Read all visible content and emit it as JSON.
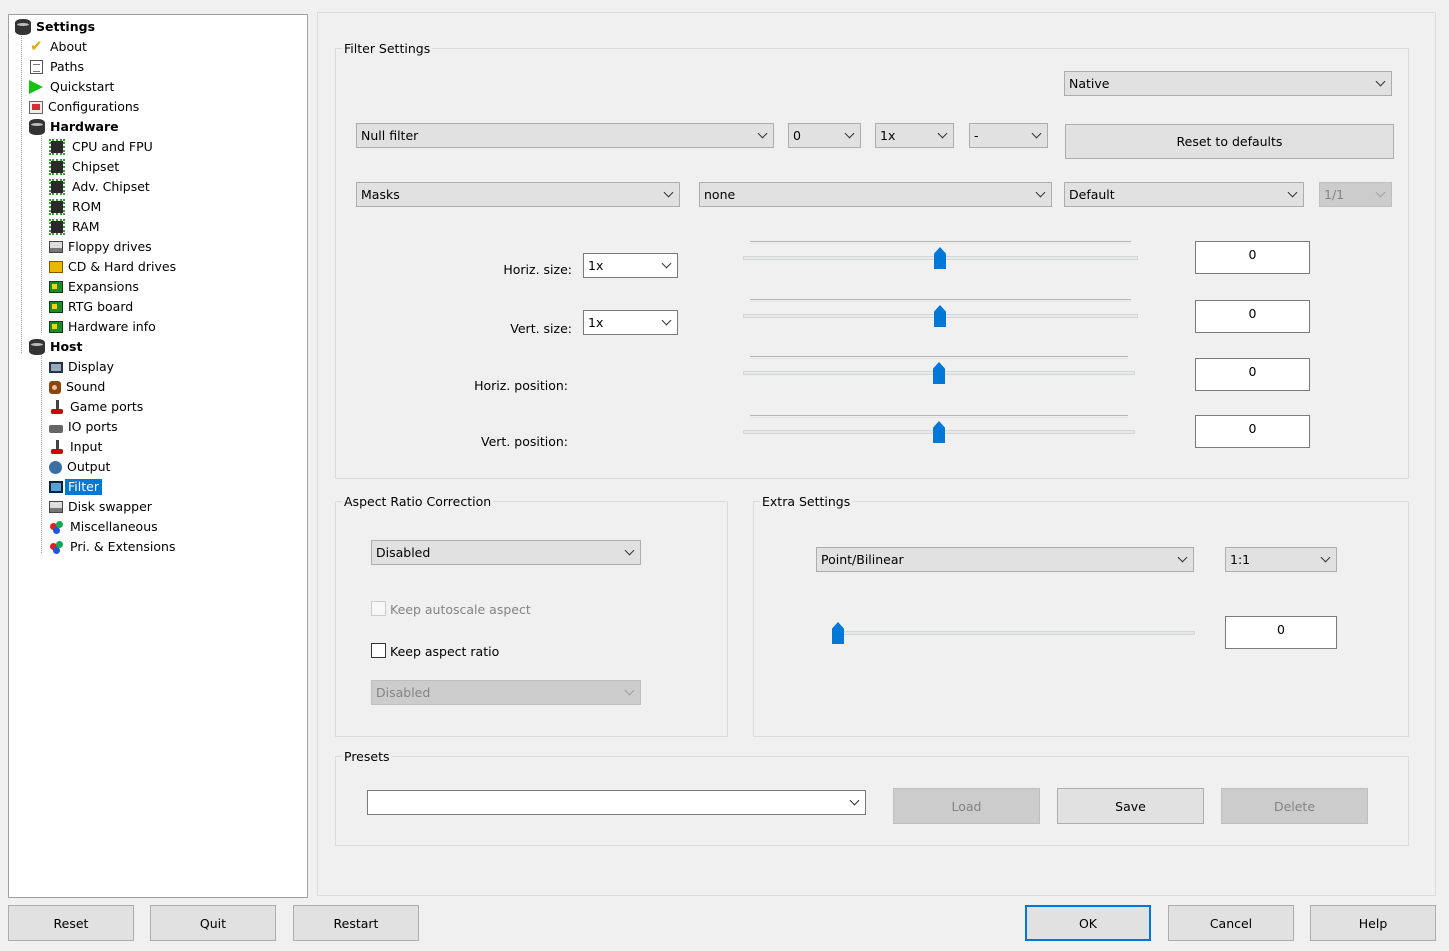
{
  "tree": {
    "items": [
      {
        "label": "Settings",
        "icon": "database-icon"
      },
      {
        "label": "About",
        "icon": "checkmark-icon"
      },
      {
        "label": "Paths",
        "icon": "document-icon"
      },
      {
        "label": "Quickstart",
        "icon": "play-icon"
      },
      {
        "label": "Configurations",
        "icon": "configurations-icon"
      },
      {
        "label": "Hardware",
        "icon": "database-icon"
      },
      {
        "label": "CPU and FPU",
        "icon": "chip-icon"
      },
      {
        "label": "Chipset",
        "icon": "chip-icon"
      },
      {
        "label": "Adv. Chipset",
        "icon": "chip-icon"
      },
      {
        "label": "ROM",
        "icon": "chip-icon"
      },
      {
        "label": "RAM",
        "icon": "chip-icon"
      },
      {
        "label": "Floppy drives",
        "icon": "floppy-icon"
      },
      {
        "label": "CD & Hard drives",
        "icon": "cd-drive-icon"
      },
      {
        "label": "Expansions",
        "icon": "expansion-card-icon"
      },
      {
        "label": "RTG board",
        "icon": "expansion-card-icon"
      },
      {
        "label": "Hardware info",
        "icon": "expansion-card-icon"
      },
      {
        "label": "Host",
        "icon": "database-icon"
      },
      {
        "label": "Display",
        "icon": "monitor-icon"
      },
      {
        "label": "Sound",
        "icon": "speaker-icon"
      },
      {
        "label": "Game ports",
        "icon": "joystick-icon"
      },
      {
        "label": "IO ports",
        "icon": "plug-icon"
      },
      {
        "label": "Input",
        "icon": "joystick-icon"
      },
      {
        "label": "Output",
        "icon": "output-icon"
      },
      {
        "label": "Filter",
        "icon": "filter-icon"
      },
      {
        "label": "Disk swapper",
        "icon": "floppy-icon"
      },
      {
        "label": "Miscellaneous",
        "icon": "misc-icon"
      },
      {
        "label": "Pri. & Extensions",
        "icon": "misc-icon"
      }
    ],
    "selected": "Filter"
  },
  "filter_settings": {
    "title": "Filter Settings",
    "mode": "Native",
    "filter": "Null filter",
    "filter_strength": "0",
    "filter_multiplier": "1x",
    "filter_extra": "-",
    "reset_label": "Reset to defaults",
    "masks": "Masks",
    "mask_value": "none",
    "overlay": "Default",
    "ratio": "1/1",
    "horiz_size_label": "Horiz. size:",
    "horiz_size": "1x",
    "horiz_size_value": "0",
    "vert_size_label": "Vert. size:",
    "vert_size": "1x",
    "vert_size_value": "0",
    "horiz_pos_label": "Horiz. position:",
    "horiz_pos_value": "0",
    "vert_pos_label": "Vert. position:",
    "vert_pos_value": "0",
    "slider_levels": [
      0.5,
      0.5,
      0.5,
      0.5
    ]
  },
  "aspect": {
    "title": "Aspect Ratio Correction",
    "mode": "Disabled",
    "keep_autoscale_label": "Keep autoscale aspect",
    "keep_autoscale_checked": false,
    "keep_aspect_label": "Keep aspect ratio",
    "keep_aspect_checked": false,
    "ratio_mode": "Disabled"
  },
  "extra": {
    "title": "Extra Settings",
    "scaling": "Point/Bilinear",
    "ratio": "1:1",
    "value": "0",
    "slider_level": 0
  },
  "presets": {
    "title": "Presets",
    "selected": "",
    "load_label": "Load",
    "save_label": "Save",
    "delete_label": "Delete"
  },
  "footer": {
    "reset_label": "Reset",
    "quit_label": "Quit",
    "restart_label": "Restart",
    "ok_label": "OK",
    "cancel_label": "Cancel",
    "help_label": "Help"
  },
  "colors": {
    "accent": "#0078d7",
    "background": "#f0f0f0"
  }
}
